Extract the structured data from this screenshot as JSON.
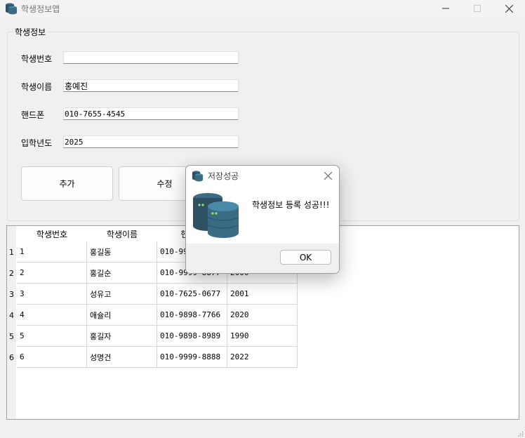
{
  "window": {
    "title": "학생정보앱"
  },
  "form": {
    "group_title": "학생정보",
    "fields": [
      {
        "label": "학생번호",
        "value": ""
      },
      {
        "label": "학생이름",
        "value": "홍예진"
      },
      {
        "label": "핸드폰",
        "value": "010-7655-4545"
      },
      {
        "label": "입학년도",
        "value": "2025"
      }
    ],
    "buttons": {
      "add": "추가",
      "edit": "수정"
    }
  },
  "table": {
    "headers": [
      "학생번호",
      "학생이름",
      "핸드폰",
      ""
    ],
    "row_numbers": [
      "1",
      "2",
      "3",
      "4",
      "5",
      "6"
    ],
    "rows": [
      [
        "1",
        "홍길동",
        "010-9999-",
        ""
      ],
      [
        "2",
        "홍길순",
        "010-9999-8877",
        "2000"
      ],
      [
        "3",
        "성유고",
        "010-7625-0677",
        "2001"
      ],
      [
        "4",
        "애슐리",
        "010-9898-7766",
        "2020"
      ],
      [
        "5",
        "홍길자",
        "010-9898-8989",
        "1990"
      ],
      [
        "6",
        "성명건",
        "010-9999-8888",
        "2022"
      ]
    ]
  },
  "dialog": {
    "title": "저장성공",
    "message": "학생정보 등록 성공!!!",
    "ok_label": "OK"
  },
  "colors": {
    "icon_dark": "#2f4f62",
    "icon_mid": "#3b6c86",
    "icon_light": "#4a8aa8",
    "led": "#9be36a"
  }
}
